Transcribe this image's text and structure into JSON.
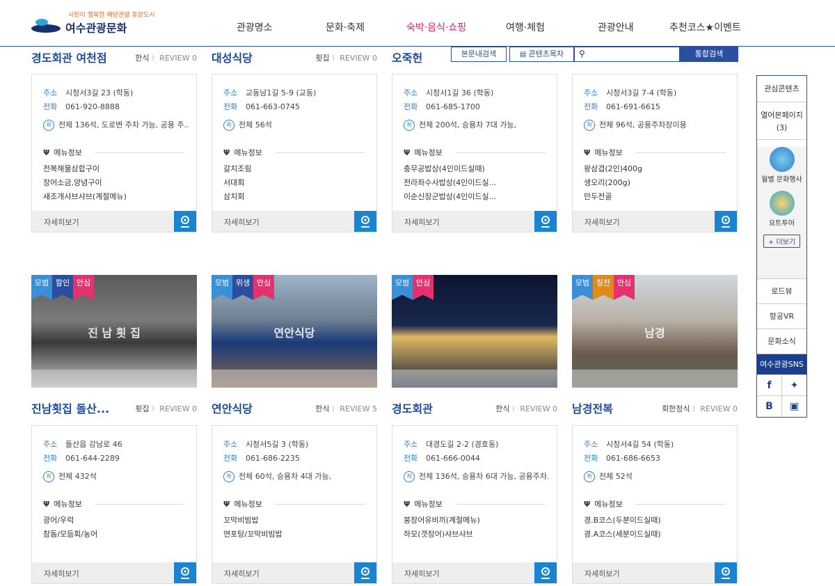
{
  "logo": {
    "slogan": "시민이 행복한 해양관광 휴양도시",
    "name": "여수관광문화"
  },
  "nav": [
    "관광명소",
    "문화·축제",
    "숙박·음식·쇼핑",
    "여행·체험",
    "관광안내",
    "추천코스★이벤트"
  ],
  "nav_active_index": 2,
  "search": {
    "btn_text": "본문내검색",
    "btn_list": "콘텐츠목차",
    "submit": "통합검색",
    "placeholder": ""
  },
  "labels": {
    "address": "주소",
    "phone": "전화",
    "menu_info": "메뉴정보",
    "detail": "자세히보기",
    "review": "REVIEW",
    "seat_icon": "좌"
  },
  "cards_row1": [
    {
      "name": "경도회관 여천점",
      "category": "한식",
      "review": "0",
      "address": "시청서3길 23 (학동)",
      "phone": "061-920-8888",
      "seats": "전체 136석, 도로변 주차 가능, 공용 주...",
      "menu": [
        "전복해물삼합구이",
        "장어소금,양념구이",
        "새조개샤브샤브(계절메뉴)"
      ]
    },
    {
      "name": "대성식당",
      "category": "횟집",
      "review": "0",
      "address": "교동남1길 5-9 (교동)",
      "phone": "061-663-0745",
      "seats": "전체 56석",
      "menu": [
        "갈치조림",
        "서대회",
        "삼치회"
      ]
    },
    {
      "name": "오죽헌",
      "category": "",
      "review": "",
      "address": "시청서1길 36 (학동)",
      "phone": "061-685-1700",
      "seats": "전체 200석, 승용차 7대 가능,",
      "menu": [
        "충무공밥상(4인이드실때)",
        "전라좌수사밥상(4인이드실...",
        "이순신장군밥상(4인이드실..."
      ]
    },
    {
      "name": "",
      "category": "",
      "review": "",
      "address": "시청서3길 7-4 (학동)",
      "phone": "061-691-6615",
      "seats": "전체 96석, 공용주차장이용",
      "menu": [
        "왕삼겹(2인)400g",
        "생오리(200g)",
        "만두전골"
      ]
    }
  ],
  "cards_row2": [
    {
      "name": "진남횟집 돌산...",
      "category": "횟집",
      "review": "0",
      "badges": [
        "모범",
        "할인",
        "안심"
      ],
      "address": "돌산읍 강남로 46",
      "phone": "061-644-2289",
      "seats": "전체 432석",
      "menu": [
        "광어/우럭",
        "참돔/모듬회/농어"
      ]
    },
    {
      "name": "연안식당",
      "category": "한식",
      "review": "5",
      "badges": [
        "모범",
        "위생",
        "안심"
      ],
      "address": "시청서5길 3 (학동)",
      "phone": "061-686-2235",
      "seats": "전체 60석, 승용차 4대 가능,",
      "menu": [
        "꼬막비빔밥",
        "연포탕/꼬막비빔밥"
      ]
    },
    {
      "name": "경도회관",
      "category": "한식",
      "review": "0",
      "badges": [
        "모범",
        "안심"
      ],
      "address": "대경도길 2-2 (경호동)",
      "phone": "061-666-0044",
      "seats": "전체 136석, 승용차 6대 가능, 공용주차...",
      "menu": [
        "붕장어유비끼(계절메뉴)",
        "하모(갯장어)샤브샤브"
      ]
    },
    {
      "name": "남경전복",
      "category": "회한정식",
      "review": "0",
      "badges": [
        "모범",
        "칭찬",
        "안심"
      ],
      "address": "시청서4길 54 (학동)",
      "phone": "061-686-6653",
      "seats": "전체 52석",
      "menu": [
        "경.B코스(두분이드실때)",
        "경.A코스(세분이드실때)"
      ]
    }
  ],
  "photo_signs": [
    "진 남 횟 집",
    "연안식당",
    "",
    "남경"
  ],
  "quick": {
    "fav": "관심콘텐츠",
    "opened": "열어본페이지",
    "opened_count": "(3)",
    "evt1": "월별 문화행사",
    "evt2": "요트투어",
    "more": "+ 더보기",
    "roadview": "로드뷰",
    "aerial": "항공VR",
    "news": "문화소식",
    "sns": "여수관광SNS"
  },
  "colors": {
    "primary": "#2a4f9e",
    "accent": "#d9226b",
    "link": "#1a84d0"
  }
}
